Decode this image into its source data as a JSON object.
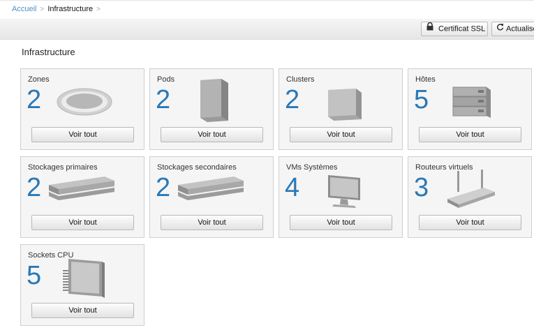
{
  "breadcrumb": {
    "home": "Accueil",
    "current": "Infrastructure",
    "separator": ">"
  },
  "toolbar": {
    "ssl_label": "Certificat SSL",
    "refresh_label": "Actualiser"
  },
  "page": {
    "title": "Infrastructure"
  },
  "cards": [
    {
      "label": "Zones",
      "count": "2",
      "button": "Voir tout",
      "icon": "zone-icon"
    },
    {
      "label": "Pods",
      "count": "2",
      "button": "Voir tout",
      "icon": "pod-icon"
    },
    {
      "label": "Clusters",
      "count": "2",
      "button": "Voir tout",
      "icon": "cluster-icon"
    },
    {
      "label": "Hôtes",
      "count": "5",
      "button": "Voir tout",
      "icon": "host-icon"
    },
    {
      "label": "Stockages primaires",
      "count": "2",
      "button": "Voir tout",
      "icon": "primary-storage-icon"
    },
    {
      "label": "Stockages secondaires",
      "count": "2",
      "button": "Voir tout",
      "icon": "secondary-storage-icon"
    },
    {
      "label": "VMs Systèmes",
      "count": "4",
      "button": "Voir tout",
      "icon": "system-vm-icon"
    },
    {
      "label": "Routeurs virtuels",
      "count": "3",
      "button": "Voir tout",
      "icon": "virtual-router-icon"
    },
    {
      "label": "Sockets CPU",
      "count": "5",
      "button": "Voir tout",
      "icon": "cpu-socket-icon"
    }
  ],
  "colors": {
    "count": "#2a78b5",
    "link": "#4a90c8",
    "card_bg": "#f5f5f5"
  }
}
